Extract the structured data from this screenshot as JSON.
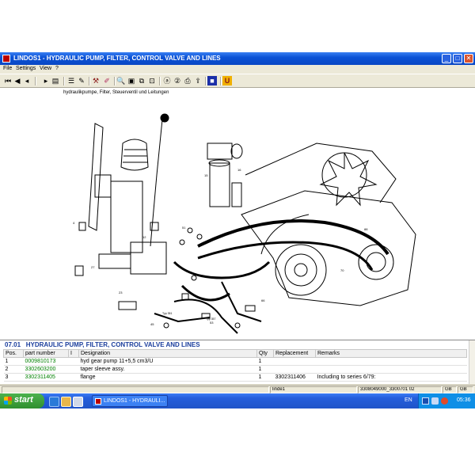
{
  "window": {
    "title": "LINDOS1 - HYDRAULIC PUMP, FILTER, CONTROL VALVE AND LINES",
    "controls": {
      "minimize": "_",
      "maximize": "□",
      "close": "✕"
    }
  },
  "menu": [
    "File",
    "Settings",
    "View",
    "?"
  ],
  "drawing": {
    "caption": "hydraulikpumpe, Filter, Steuerventil und Leitungen",
    "labels": [
      "Typ 351",
      "Typ 357"
    ]
  },
  "parts": {
    "section_code": "07.01",
    "section_title": "HYDRAULIC PUMP, FILTER, CONTROL VALVE AND LINES",
    "columns": [
      "Pos.",
      "part number",
      "I",
      "Designation",
      "Qty",
      "Replacement",
      "Remarks"
    ],
    "rows": [
      {
        "pos": "1",
        "part_number": "0009810173",
        "i": "",
        "designation": "hyd gear pump 11+5,5 cm3/U",
        "qty": "1",
        "replacement": "",
        "remarks": ""
      },
      {
        "pos": "2",
        "part_number": "3302603200",
        "i": "",
        "designation": "taper sleeve assy.",
        "qty": "1",
        "replacement": "",
        "remarks": ""
      },
      {
        "pos": "3",
        "part_number": "3302311405",
        "i": "",
        "designation": "flange",
        "qty": "1",
        "replacement": "3302311406",
        "remarks": "Including to series 6/79:"
      }
    ]
  },
  "statusbar": {
    "model": "linde1",
    "reference": "3308049000_3300701 02",
    "lang1": "GB",
    "lang2": "GB"
  },
  "taskbar": {
    "start_label": "start",
    "task_label": "LINDOS1 - HYDRAULI...",
    "language": "EN",
    "clock": "05:36"
  }
}
